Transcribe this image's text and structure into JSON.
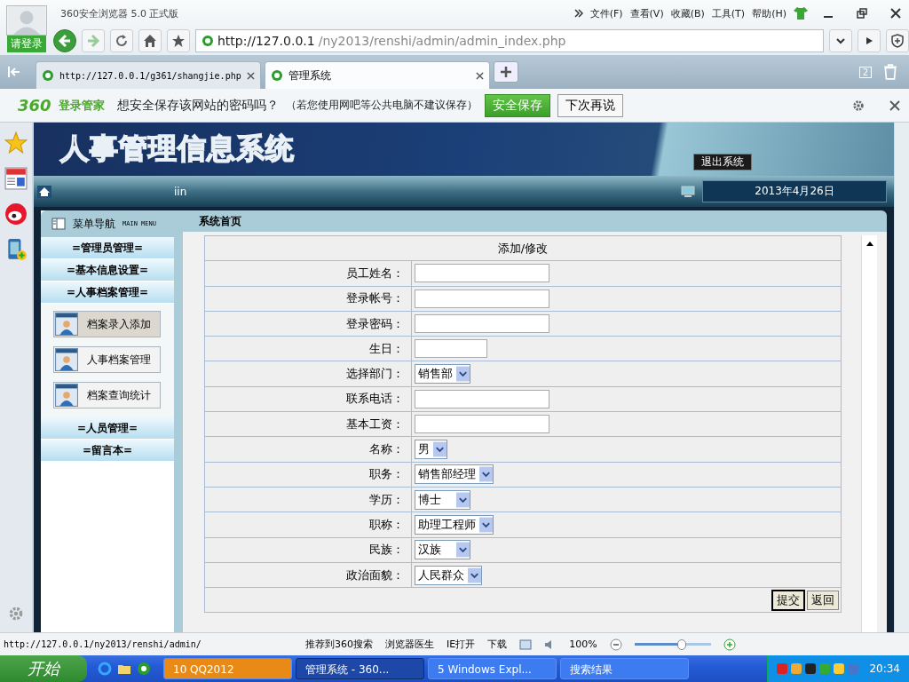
{
  "browser": {
    "title": "360安全浏览器 5.0 正式版",
    "login": "请登录",
    "menu": [
      "文件(F)",
      "查看(V)",
      "收藏(B)",
      "工具(T)",
      "帮助(H)"
    ],
    "address": {
      "host": "http://127.0.0.1",
      "path": "/ny2013/renshi/admin/admin_index.php"
    },
    "tabs": [
      {
        "title": "http://127.0.0.1/g361/shangjie.php",
        "selected": false
      },
      {
        "title": "管理系统",
        "selected": true
      }
    ],
    "tab_count": "2"
  },
  "password_bar": {
    "brand": "360",
    "product": "登录管家",
    "question": "想安全保存该网站的密码吗？",
    "note": "（若您使用网吧等公共电脑不建议保存）",
    "save": "安全保存",
    "later": "下次再说"
  },
  "header": {
    "title": "人事管理信息系统",
    "logout": "退出系统",
    "user": "iin",
    "date": "2013年4月26日"
  },
  "menu": {
    "title": "菜单导航",
    "subtitle": "MAIN MENU",
    "sections": [
      {
        "label": "=管理员管理="
      },
      {
        "label": "=基本信息设置="
      },
      {
        "label": "=人事档案管理=",
        "children": [
          {
            "label": "档案录入添加",
            "selected": true
          },
          {
            "label": "人事档案管理",
            "selected": false
          },
          {
            "label": "档案查询统计",
            "selected": false
          }
        ]
      },
      {
        "label": "=人员管理="
      },
      {
        "label": "=留言本="
      }
    ]
  },
  "breadcrumb": "系统首页",
  "form": {
    "title": "添加/修改",
    "fields": [
      {
        "label": "员工姓名：",
        "kind": "text"
      },
      {
        "label": "登录帐号：",
        "kind": "text"
      },
      {
        "label": "登录密码：",
        "kind": "text"
      },
      {
        "label": "生日：",
        "kind": "date"
      },
      {
        "label": "选择部门：",
        "kind": "select",
        "value": "销售部"
      },
      {
        "label": "联系电话：",
        "kind": "text"
      },
      {
        "label": "基本工资：",
        "kind": "text"
      },
      {
        "label": "名称：",
        "kind": "select",
        "value": "男"
      },
      {
        "label": "职务：",
        "kind": "select",
        "value": "销售部经理"
      },
      {
        "label": "学历：",
        "kind": "select",
        "value": "博士　"
      },
      {
        "label": "职称：",
        "kind": "select",
        "value": "助理工程师"
      },
      {
        "label": "民族：",
        "kind": "select",
        "value": "汉族　"
      },
      {
        "label": "政治面貌：",
        "kind": "select",
        "value": "人民群众"
      }
    ],
    "buttons": [
      "提交",
      "返回"
    ]
  },
  "status": {
    "url": "http://127.0.0.1/ny2013/renshi/admin/",
    "items": [
      "推荐到360搜索",
      "浏览器医生",
      "IE打开",
      "下载"
    ],
    "zoom": "100%",
    "level": 0.62
  },
  "taskbar": {
    "start": "开始",
    "tasks": [
      {
        "label": "10 QQ2012",
        "selected": false,
        "flashing": true
      },
      {
        "label": "管理系统 - 360...",
        "selected": true,
        "flashing": false
      },
      {
        "label": "5 Windows Expl...",
        "selected": false,
        "flashing": false
      },
      {
        "label": "搜索结果",
        "selected": false,
        "flashing": false
      }
    ],
    "clock": "20:34"
  }
}
